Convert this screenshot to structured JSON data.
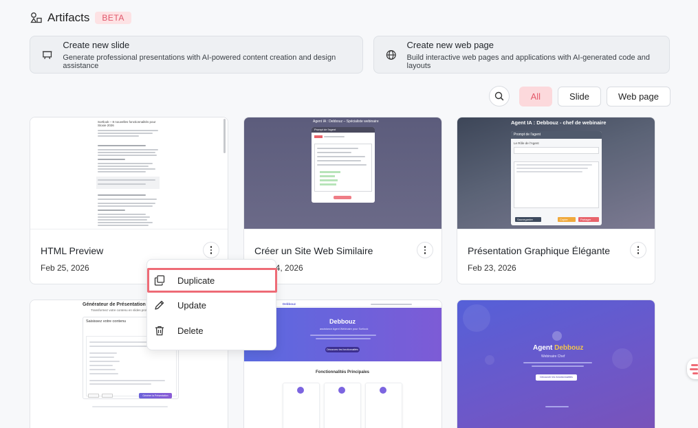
{
  "header": {
    "title": "Artifacts",
    "badge": "BETA"
  },
  "create": [
    {
      "title": "Create new slide",
      "desc": "Generate professional presentations with AI-powered content creation and design assistance",
      "icon": "presentation-icon"
    },
    {
      "title": "Create new web page",
      "desc": "Build interactive web pages and applications with AI-generated code and layouts",
      "icon": "globe-icon"
    }
  ],
  "filters": {
    "all": "All",
    "slide": "Slide",
    "web": "Web page"
  },
  "cards": [
    {
      "name": "HTML Preview",
      "date": "Feb 25, 2026"
    },
    {
      "name": "Créer un Site Web Similaire",
      "date": "Feb 24, 2026"
    },
    {
      "name": "Présentation Graphique Élégante",
      "date": "Feb 23, 2026"
    }
  ],
  "menu": {
    "duplicate": "Duplicate",
    "update": "Update",
    "delete": "Delete"
  },
  "thumbs": {
    "t1_title": "Sortlook – 8 nouvelles fonctionnalités pour Stoxie 2026",
    "t2_header": "Agent IA : Debbouz – Spécialiste webinaire",
    "t2_modal": "Prompt de l'agent",
    "t3_header": "Agent IA : Debbouz - chef de webinaire",
    "t3_modal": "Prompt de l'agent",
    "t3_field": "Le Rôle de l'Agent",
    "t3_btn1": "Sauvegarder",
    "t3_btn2": "Copier",
    "t3_btn3": "Partager",
    "t4_title": "Générateur de Présentation Interacti",
    "t4_sub": "Transformez votre contenu en slides professionnelles",
    "t4_label": "Saisissez votre contenu",
    "t4_btn": "Générer la Présentation",
    "t5_brand": "Debbouz",
    "t5_hero": "Debbouz",
    "t5_sub": "assistance Agent Webinaire pour Sortlook",
    "t5_cta": "Découvrez les fonctionnalités",
    "t5_section": "Fonctionnalités Principales",
    "t6_title_a": "Agent ",
    "t6_title_b": "Debbouz",
    "t6_sub": "Webinaire Chef",
    "t6_cta": "Découvrir les fonctionnalités"
  },
  "colors": {
    "accent": "#e45a6a",
    "highlight": "#ee6b76"
  }
}
